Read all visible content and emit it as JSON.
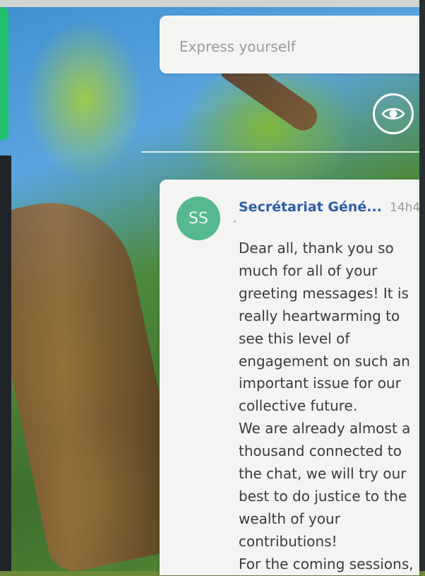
{
  "composer": {
    "placeholder": "Express yourself"
  },
  "visibility_toggle": {
    "icon": "eye-icon"
  },
  "post": {
    "avatar_initials": "SS",
    "avatar_color": "#55b88e",
    "author": "Secrétariat Géné...",
    "time": "14h4",
    "paragraphs": [
      "Dear all, thank you so much for all of your greeting messages! It is really heartwarming to see this level of engagement on such an important issue for our collective future.",
      "We are already almost a thousand connected to the chat, we will try our best to do justice to the wealth of your contributions!",
      "For the coming sessions,"
    ]
  },
  "colors": {
    "accent_green": "#1fbf6b",
    "author_blue": "#2d5ea8",
    "card_bg": "#f4f4f2"
  }
}
